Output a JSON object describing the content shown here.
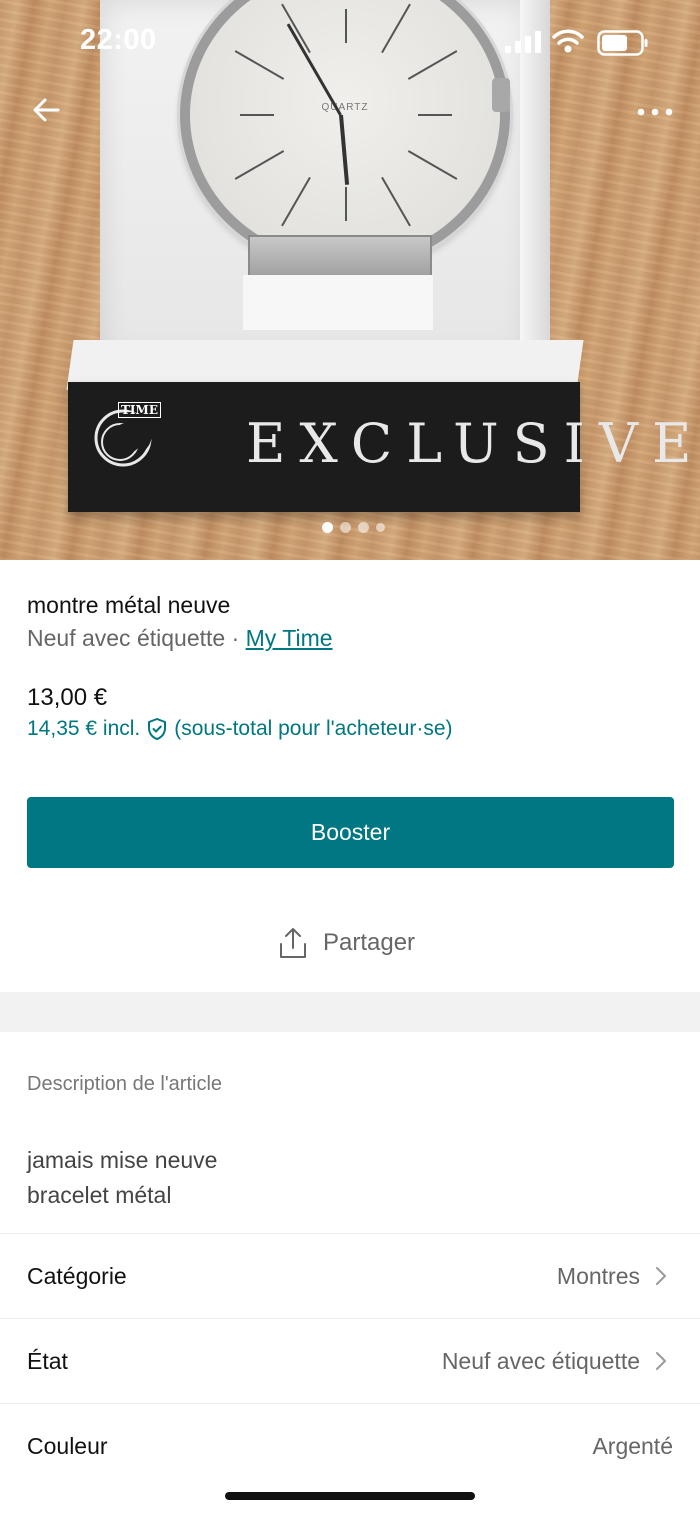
{
  "status_bar": {
    "time": "22:00"
  },
  "hero": {
    "band_text": "EXCLUSIVE",
    "logo_tag": "TIME",
    "dial_text": "QUARTZ",
    "carousel_count": 4,
    "carousel_active": 1
  },
  "item": {
    "title": "montre métal neuve",
    "condition": "Neuf avec étiquette",
    "separator": "·",
    "brand": "My Time",
    "price": "13,00 €",
    "price_incl": "14,35 € incl.",
    "price_incl_note": "(sous-total pour l'acheteur·se)"
  },
  "actions": {
    "booster": "Booster",
    "share": "Partager"
  },
  "description": {
    "label": "Description de l'article",
    "lines": [
      "jamais mise neuve",
      "bracelet métal"
    ]
  },
  "attributes": [
    {
      "key": "Catégorie",
      "value": "Montres",
      "chevron": true
    },
    {
      "key": "État",
      "value": "Neuf avec étiquette",
      "chevron": true
    },
    {
      "key": "Couleur",
      "value": "Argenté",
      "chevron": false
    }
  ],
  "colors": {
    "accent": "#007782",
    "text": "#111111",
    "muted": "#666666"
  },
  "icons": [
    "back-arrow-icon",
    "more-icon",
    "shield-icon",
    "share-icon",
    "chevron-right-icon"
  ]
}
